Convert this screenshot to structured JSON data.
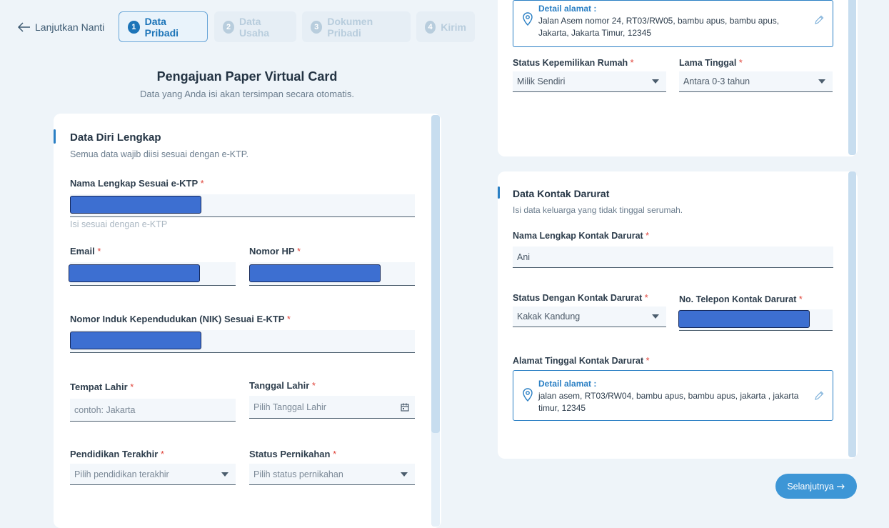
{
  "header": {
    "back_label": "Lanjutkan Nanti",
    "steps": [
      {
        "num": "1",
        "label": "Data Pribadi"
      },
      {
        "num": "2",
        "label": "Data Usaha"
      },
      {
        "num": "3",
        "label": "Dokumen Pribadi"
      },
      {
        "num": "4",
        "label": "Kirim"
      }
    ]
  },
  "page": {
    "title": "Pengajuan Paper Virtual Card",
    "subtitle": "Data yang Anda isi akan tersimpan secara otomatis."
  },
  "personal": {
    "title": "Data Diri Lengkap",
    "subtitle": "Semua data wajib diisi sesuai dengan e-KTP.",
    "full_name_label": "Nama Lengkap Sesuai e-KTP",
    "full_name_hint": "Isi sesuai dengan e-KTP",
    "email_label": "Email",
    "phone_label": "Nomor HP",
    "nik_label": "Nomor Induk Kependudukan (NIK) Sesuai E-KTP",
    "birthplace_label": "Tempat Lahir",
    "birthplace_placeholder": "contoh: Jakarta",
    "birthdate_label": "Tanggal Lahir",
    "birthdate_placeholder": "Pilih Tanggal Lahir",
    "education_label": "Pendidikan Terakhir",
    "education_placeholder": "Pilih pendidikan terakhir",
    "marital_label": "Status Pernikahan",
    "marital_placeholder": "Pilih status pernikahan",
    "required_mark": "*"
  },
  "residence": {
    "address_heading": "Detail alamat :",
    "address_text": "Jalan Asem nomor 24, RT03/RW05, bambu apus, bambu apus, Jakarta, Jakarta Timur, 12345",
    "ownership_label": "Status Kepemilikan Rumah",
    "ownership_value": "Milik Sendiri",
    "duration_label": "Lama Tinggal",
    "duration_value": "Antara 0-3 tahun"
  },
  "emergency": {
    "title": "Data Kontak Darurat",
    "subtitle": "Isi data keluarga yang tidak tinggal serumah.",
    "name_label": "Nama Lengkap Kontak Darurat",
    "name_value": "Ani",
    "relation_label": "Status Dengan Kontak Darurat",
    "relation_value": "Kakak Kandung",
    "phone_label": "No. Telepon Kontak Darurat",
    "address_label": "Alamat Tinggal Kontak Darurat",
    "address_heading": "Detail alamat :",
    "address_text": "jalan asem, RT03/RW04, bambu apus, bambu apus, jakarta , jakarta timur, 12345"
  },
  "footer": {
    "next_label": "Selanjutnya"
  },
  "icons": {
    "back": "arrow-left-icon",
    "location": "location-pin-icon",
    "edit": "pencil-icon",
    "calendar": "calendar-icon",
    "dropdown": "caret-down-icon",
    "next": "arrow-right-icon"
  },
  "colors": {
    "accent": "#2a7fc4",
    "required": "#e0463c",
    "button": "#3d96d6",
    "redaction": "#3d6fd1"
  }
}
